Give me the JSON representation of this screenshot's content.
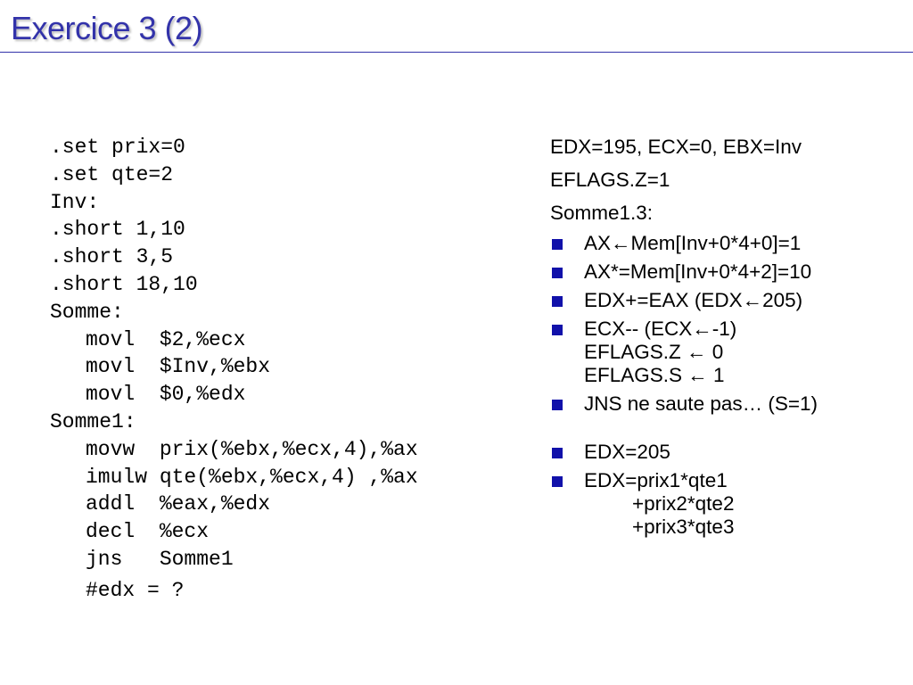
{
  "slide": {
    "title": "Exercice 3 (2)",
    "title_color": "#3333AA",
    "bullet_color": "#1111AA"
  },
  "code": {
    "lines": [
      ".set prix=0",
      ".set qte=2",
      "Inv:",
      ".short 1,10",
      ".short 3,5",
      ".short 18,10",
      "Somme:",
      "movl  $2,%ecx",
      "movl  $Inv,%ebx",
      "movl  $0,%edx",
      "Somme1:",
      "movw  prix(%ebx,%ecx,4),%ax",
      "imulw qte(%ebx,%ecx,4) ,%ax",
      "addl  %eax,%edx",
      "decl  %ecx",
      "jns   Somme1",
      "#edx = ?"
    ]
  },
  "notes": {
    "line1": "EDX=195, ECX=0, EBX=Inv",
    "line2": "EFLAGS.Z=1",
    "line3": "Somme1.3:",
    "b1": "AX←Mem[Inv+0*4+0]=1",
    "b2": "AX*=Mem[Inv+0*4+2]=10",
    "b3": "EDX+=EAX (EDX←205)",
    "b4_l1": "ECX-- (ECX←-1)",
    "b4_l2": "EFLAGS.Z ← 0",
    "b4_l3": "EFLAGS.S ← 1",
    "b5": "JNS ne saute pas… (S=1)",
    "b6": "EDX=205",
    "b7_l1": "EDX=prix1*qte1",
    "b7_l2": "+prix2*qte2",
    "b7_l3": "+prix3*qte3"
  }
}
